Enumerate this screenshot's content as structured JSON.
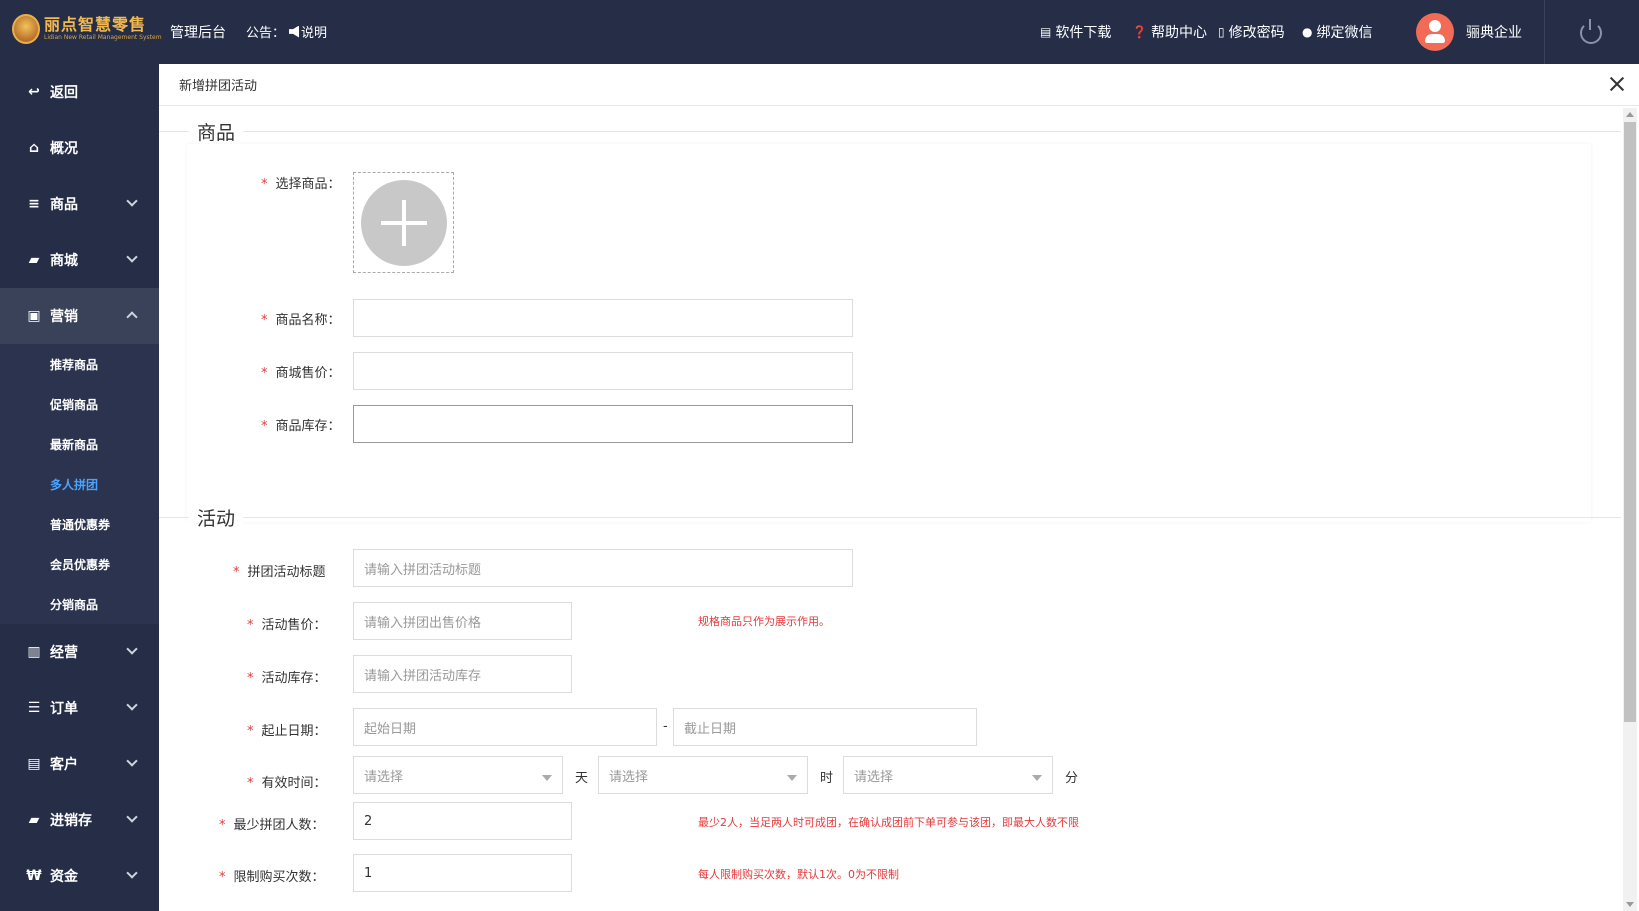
{
  "topbar": {
    "logo_title": "丽点智慧零售",
    "logo_subtitle": "Lidian New Retail Management System",
    "admin_label": "管理后台",
    "notice_label": "公告：",
    "notice_text": "说明",
    "links": [
      "软件下载",
      "帮助中心",
      "修改密码",
      "绑定微信"
    ],
    "company": "骊典企业"
  },
  "sidebar": {
    "items": [
      {
        "label": "返回",
        "icon": "back-arrow-icon"
      },
      {
        "label": "概况",
        "icon": "home-icon"
      },
      {
        "label": "商品",
        "icon": "list-icon"
      },
      {
        "label": "商城",
        "icon": "shopping-bag-icon"
      },
      {
        "label": "营销",
        "icon": "gift-icon"
      },
      {
        "label": "经营",
        "icon": "bar-chart-icon"
      },
      {
        "label": "订单",
        "icon": "list-icon"
      },
      {
        "label": "客户",
        "icon": "id-card-icon"
      },
      {
        "label": "进销存",
        "icon": "truck-icon"
      },
      {
        "label": "资金",
        "icon": "won-icon"
      }
    ],
    "sub_items": [
      "推荐商品",
      "促销商品",
      "最新商品",
      "多人拼团",
      "普通优惠券",
      "会员优惠券",
      "分销商品"
    ],
    "active_sub": "多人拼团",
    "accent_color": "#4aa3ff"
  },
  "panel": {
    "title": "新增拼团活动",
    "section_product": "商品",
    "section_activity": "活动",
    "product": {
      "select_label": "选择商品：",
      "name_label": "商品名称：",
      "price_label": "商城售价：",
      "stock_label": "商品库存：",
      "name_value": "",
      "price_value": "",
      "stock_value": ""
    },
    "activity": {
      "title_label": "拼团活动标题",
      "title_placeholder": "请输入拼团活动标题",
      "price_label": "活动售价：",
      "price_placeholder": "请输入拼团出售价格",
      "price_hint": "规格商品只作为展示作用。",
      "stock_label": "活动库存：",
      "stock_placeholder": "请输入拼团活动库存",
      "date_label": "起止日期：",
      "start_placeholder": "起始日期",
      "date_sep": "-",
      "end_placeholder": "截止日期",
      "valid_label": "有效时间：",
      "select_placeholder": "请选择",
      "unit_day": "天",
      "unit_hour": "时",
      "unit_min": "分",
      "min_label": "最少拼团人数：",
      "min_value": "2",
      "min_hint": "最少2人，当足两人时可成团，在确认成团前下单可参与该团，即最大人数不限",
      "limit_label": "限制购买次数：",
      "limit_value": "1",
      "limit_hint": "每人限制购买次数，默认1次。0为不限制"
    }
  }
}
